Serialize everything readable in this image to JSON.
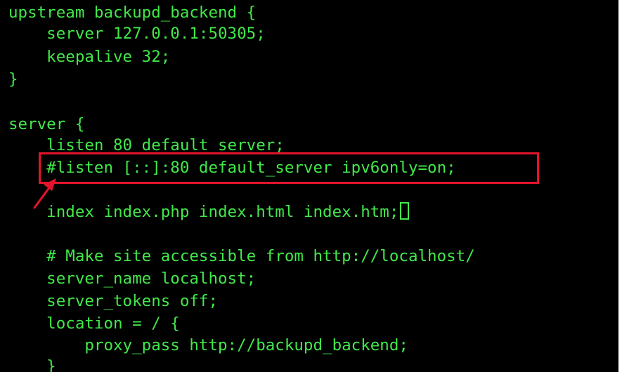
{
  "editor": {
    "lines": [
      "upstream backupd_backend {",
      "    server 127.0.0.1:50305;",
      "    keepalive 32;",
      "}",
      "",
      "server {",
      "    listen 80 default_server;",
      "    #listen [::]:80 default_server ipv6only=on;",
      "",
      "    index index.php index.html index.htm;",
      "",
      "    # Make site accessible from http://localhost/",
      "    server_name localhost;",
      "    server_tokens off;",
      "    location = / {",
      "        proxy_pass http://backupd_backend;",
      "    }"
    ]
  },
  "annotation": {
    "highlighted_line": "#listen [::]:80 default_server ipv6only=on;",
    "box_color": "#e3142b",
    "arrow_color": "#e3142b"
  },
  "colors": {
    "background": "#000000",
    "text": "#42e84a"
  }
}
